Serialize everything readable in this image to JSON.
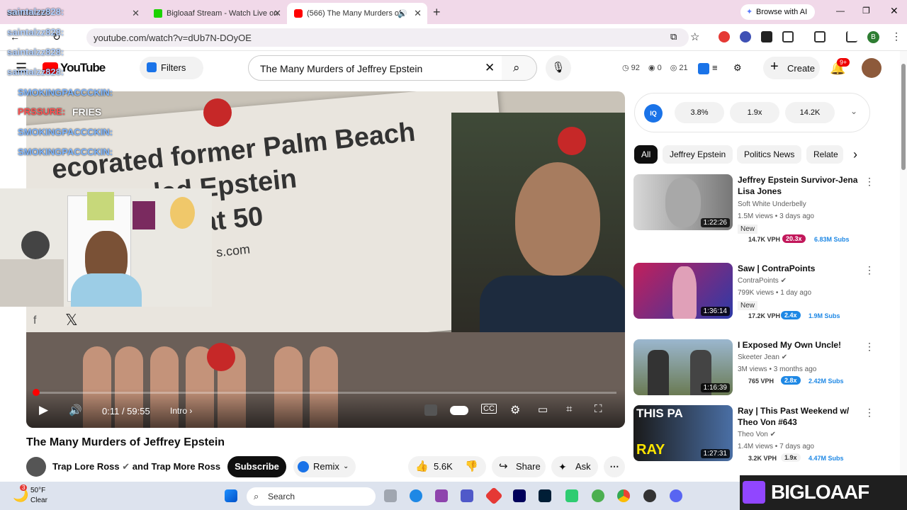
{
  "browser": {
    "tabs": [
      {
        "label": "saintalzz828"
      },
      {
        "label": "Bigloaaf Stream - Watch Live on"
      },
      {
        "label": "(566) The Many Murders of"
      }
    ],
    "new_tab": "+",
    "browse_ai": "Browse with AI",
    "url": "youtube.com/watch?v=dUb7N-DOyOE",
    "profile_initial": "B"
  },
  "youtube": {
    "logo": "YouTube",
    "filters": "Filters",
    "search_value": "The Many Murders of Jeffrey Epstein",
    "stats": {
      "a": "92",
      "b": "0",
      "c": "21"
    },
    "create": "Create",
    "notifications": "9+"
  },
  "video": {
    "headline": "ecorated former Palm Beach\n          o led Epstein\n           dies at 50",
    "site_text": "s.com",
    "time": "0:11 / 59:55",
    "chapter": "Intro",
    "progress_fraction": 0.003
  },
  "stream_overlay": {
    "chat": [
      {
        "user": "saintalzz828:"
      },
      {
        "user": "saintalzz828:"
      },
      {
        "user": "saintalzz828:"
      },
      {
        "user": "saintalzz828:"
      },
      {
        "user": "SMOKINGPACCCKIN:"
      },
      {
        "user": "PRSSURE:",
        "msg": "FRIES"
      },
      {
        "user": "SMOKINGPACCCKIN:"
      },
      {
        "user": "SMOKINGPACCCKIN:"
      }
    ]
  },
  "watch": {
    "title": "The Many Murders of Jeffrey Epstein",
    "channel": "Trap Lore Ross",
    "and_text": "and Trap More Ross",
    "subscribe": "Subscribe",
    "remix": "Remix",
    "likes": "5.6K",
    "share": "Share",
    "ask": "Ask"
  },
  "sidebar": {
    "iq_stats": [
      "3.8%",
      "1.9x",
      "14.2K"
    ],
    "chips": [
      "All",
      "Jeffrey Epstein",
      "Politics News",
      "Relate"
    ],
    "recommendations": [
      {
        "title": "Jeffrey Epstein Survivor-Jena Lisa Jones",
        "channel": "Soft White Underbelly",
        "meta": "1.5M views • 3 days ago",
        "new": "New",
        "duration": "1:22:26",
        "vph": "14.7K VPH",
        "mult": "20.3x",
        "subs": "6.83M Subs",
        "mult_color": "#c2185b"
      },
      {
        "title": "Saw | ContraPoints",
        "channel": "ContraPoints",
        "meta": "799K views • 1 day ago",
        "new": "New",
        "duration": "1:36:14",
        "vph": "17.2K VPH",
        "mult": "2.4x",
        "subs": "1.9M Subs",
        "mult_color": "#1e88e5"
      },
      {
        "title": "I Exposed My Own Uncle!",
        "channel": "Skeeter Jean",
        "meta": "3M views • 3 months ago",
        "new": "",
        "duration": "1:16:39",
        "vph": "765 VPH",
        "mult": "2.8x",
        "subs": "2.42M Subs",
        "mult_color": "#1e88e5"
      },
      {
        "title": "Ray | This Past Weekend w/ Theo Von #643",
        "channel": "Theo Von",
        "meta": "1.4M views • 7 days ago",
        "new": "",
        "duration": "1:27:31",
        "vph": "3.2K VPH",
        "mult": "1.9x",
        "subs": "4.47M Subs",
        "mult_color": "#f2f2f2"
      }
    ]
  },
  "taskbar": {
    "weather_temp": "50°F",
    "weather_desc": "Clear",
    "weather_badge": "3",
    "search": "Search",
    "twitch_name": "BIGLOAAF"
  }
}
